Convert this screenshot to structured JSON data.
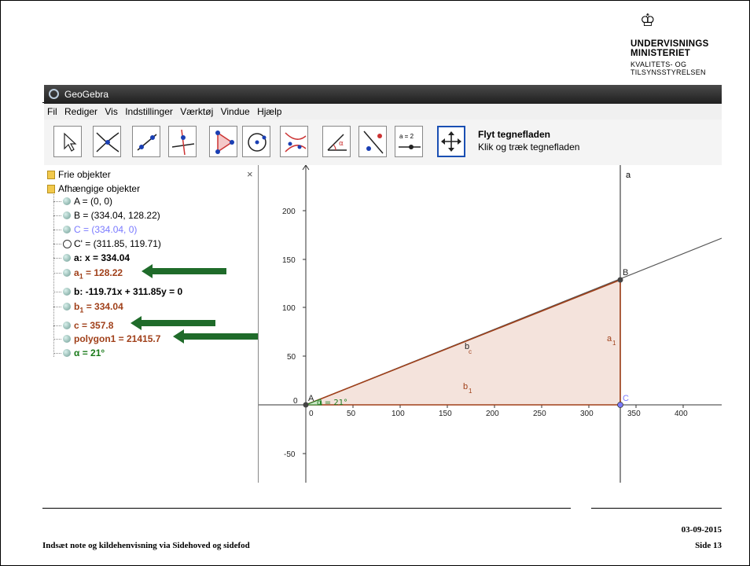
{
  "logo": {
    "line1": "UNDERVISNINGS",
    "line2": "MINISTERIET",
    "line3": "KVALITETS- OG",
    "line4": "TILSYNSSTYRELSEN"
  },
  "window": {
    "title": "GeoGebra",
    "menu": [
      "Fil",
      "Rediger",
      "Vis",
      "Indstillinger",
      "Værktøj",
      "Vindue",
      "Hjælp"
    ],
    "tool_title": "Flyt tegnefladen",
    "tool_desc": "Klik og træk tegnefladen",
    "slider_tool_label": "a = 2"
  },
  "algebra": {
    "close": "×",
    "free_label": "Frie objekter",
    "dependent_label": "Afhængige objekter",
    "items": [
      {
        "text": "A = (0, 0)",
        "color": "#000000"
      },
      {
        "text": "B = (334.04, 128.22)",
        "color": "#000000"
      },
      {
        "text": "C = (334.04, 0)",
        "color": "#7a7aff"
      },
      {
        "text": "C' = (311.85, 119.71)",
        "color": "#000000"
      },
      {
        "text": "a: x = 334.04",
        "color": "#000000"
      },
      {
        "text": "a",
        "sub": "1",
        "rest": " = 128.22",
        "color": "#a0401a"
      },
      {
        "text": "b: -119.71x + 311.85y = 0",
        "color": "#000000"
      },
      {
        "text": "b",
        "sub": "1",
        "rest": " = 334.04",
        "color": "#a0401a"
      },
      {
        "text": "c = 357.8",
        "color": "#a0401a"
      },
      {
        "text": "polygon1 = 21415.7",
        "color": "#a0401a"
      },
      {
        "text": "α = 21°",
        "color": "#1a7a1a"
      }
    ]
  },
  "graph": {
    "x_ticks": [
      "0",
      "50",
      "100",
      "150",
      "200",
      "250",
      "300",
      "350",
      "400"
    ],
    "y_ticks": [
      "200",
      "150",
      "100",
      "50",
      "0",
      "-50"
    ],
    "label_a": "a",
    "label_A": "A",
    "label_B": "B",
    "label_C": "C",
    "label_a1": "a",
    "label_a1_sub": "1",
    "label_b1": "b",
    "label_b1_sub": "1",
    "label_bc": "b",
    "label_bc_sub": "c",
    "label_alpha": "α = 21°",
    "colors": {
      "polygon_fill": "#f4e3dc",
      "polygon_edge": "#a0401a",
      "line": "#555555",
      "alpha": "#1a7a1a",
      "point_C": "#7a7aff"
    }
  },
  "footer": {
    "note": "Indsæt note og kildehenvisning via Sidehoved og sidefod",
    "date": "03-09-2015",
    "page": "Side 13"
  }
}
